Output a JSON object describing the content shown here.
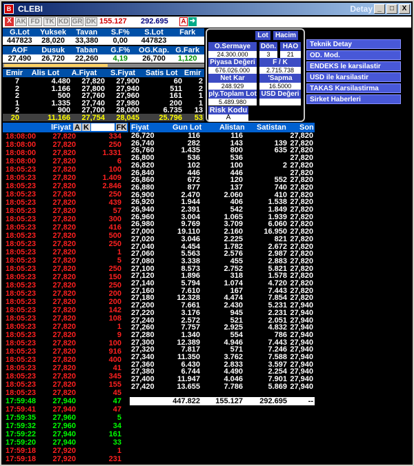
{
  "window": {
    "title": "CLEBI",
    "subtitle": "Detay",
    "buttons": {
      "minimize": "_",
      "maximize": "□",
      "close": "X"
    }
  },
  "toolbar": {
    "close_box": "X",
    "tabs": [
      "AK",
      "FD",
      "TK",
      "KD",
      "GR",
      "DK"
    ],
    "value1": "155.127",
    "value2": "292.695",
    "a_label": "A"
  },
  "quote": {
    "header1": [
      "G.Lot",
      "Yuksek",
      "Tavan",
      "S.F%",
      "S.Lot",
      "Fark"
    ],
    "values1": [
      "447823",
      "28,020",
      "33,380",
      "0,00",
      "447823",
      ""
    ],
    "header2": [
      "AOF",
      "Dusuk",
      "Taban",
      "G.F%",
      "OG.Kap.",
      "G.Fark"
    ],
    "values2": [
      "27,490",
      "26,720",
      "22,260",
      "4,19",
      "26,700",
      "1,120"
    ],
    "orders_header": [
      "Emir",
      "Alis Lot",
      "A.Fiyat",
      "S.Fiyat",
      "Satis Lot",
      "Emir"
    ],
    "orders": [
      [
        "7",
        "4.480",
        "27,820",
        "27,900",
        "60",
        "2"
      ],
      [
        "2",
        "1.166",
        "27,800",
        "27,940",
        "511",
        "2"
      ],
      [
        "2",
        "500",
        "27,760",
        "27,960",
        "161",
        "1"
      ],
      [
        "1",
        "1.335",
        "27,740",
        "27,980",
        "200",
        "1"
      ],
      [
        "2",
        "900",
        "27,700",
        "28,000",
        "6.735",
        "13"
      ],
      [
        "20",
        "11.166",
        "27,754",
        "28,045",
        "25.796",
        "53"
      ]
    ]
  },
  "detail": {
    "tabs": [
      "Lot",
      "Hacim"
    ],
    "o_sermaye_label": "O.Sermaye",
    "o_sermaye_value": "24.300.000",
    "don_label": "Dön.",
    "don_value": "3",
    "hao_label": "HAO",
    "hao_value": "21",
    "piyasa_label": "Piyasa Değeri",
    "piyasa_value": "676.026.000",
    "fk_label": "F / K",
    "fk_value": "2.715.738",
    "netkar_label": "Net Kar",
    "netkar_value": "248.929",
    "sapma_label": "'Sapma",
    "sapma_value": "16.5000",
    "plytoplam_label": "ply.Toplam Lot",
    "plytoplam_value": "5.489.980",
    "usd_label": "USD Değeri",
    "risk_label": "Risk Kodu",
    "risk_value": "A"
  },
  "links": [
    "Teknik Detay",
    "OD. Mod.",
    "ENDEKS le karsilastir",
    "USD ile karsilastir",
    "TAKAS Karsilastirma",
    "Sirket Haberleri"
  ],
  "order_list": {
    "header": {
      "price": "lFiyat",
      "a": "A",
      "k": "K",
      "fk": "FK"
    },
    "rows": [
      [
        "18:08:00",
        "27,820",
        "334",
        "r"
      ],
      [
        "18:08:00",
        "27,820",
        "250",
        "r"
      ],
      [
        "18:08:00",
        "27,820",
        "1.331",
        "r"
      ],
      [
        "18:08:00",
        "27,820",
        "6",
        "r"
      ],
      [
        "18:05:23",
        "27,820",
        "100",
        "r"
      ],
      [
        "18:05:23",
        "27,820",
        "1.409",
        "r"
      ],
      [
        "18:05:23",
        "27,820",
        "2.846",
        "r"
      ],
      [
        "18:05:23",
        "27,820",
        "250",
        "r"
      ],
      [
        "18:05:23",
        "27,820",
        "439",
        "r"
      ],
      [
        "18:05:23",
        "27,820",
        "57",
        "r"
      ],
      [
        "18:05:23",
        "27,820",
        "300",
        "r"
      ],
      [
        "18:05:23",
        "27,820",
        "416",
        "r"
      ],
      [
        "18:05:23",
        "27,820",
        "500",
        "r"
      ],
      [
        "18:05:23",
        "27,820",
        "250",
        "r"
      ],
      [
        "18:05:23",
        "27,820",
        "1",
        "r"
      ],
      [
        "18:05:23",
        "27,820",
        "5",
        "r"
      ],
      [
        "18:05:23",
        "27,820",
        "250",
        "r"
      ],
      [
        "18:05:23",
        "27,820",
        "150",
        "r"
      ],
      [
        "18:05:23",
        "27,820",
        "250",
        "r"
      ],
      [
        "18:05:23",
        "27,820",
        "200",
        "r"
      ],
      [
        "18:05:23",
        "27,820",
        "200",
        "r"
      ],
      [
        "18:05:23",
        "27,820",
        "142",
        "r"
      ],
      [
        "18:05:23",
        "27,820",
        "108",
        "r"
      ],
      [
        "18:05:23",
        "27,820",
        "1",
        "r"
      ],
      [
        "18:05:23",
        "27,820",
        "9",
        "r"
      ],
      [
        "18:05:23",
        "27,820",
        "100",
        "r"
      ],
      [
        "18:05:23",
        "27,820",
        "916",
        "r"
      ],
      [
        "18:05:23",
        "27,820",
        "400",
        "r"
      ],
      [
        "18:05:23",
        "27,820",
        "41",
        "r"
      ],
      [
        "18:05:23",
        "27,820",
        "345",
        "r"
      ],
      [
        "18:05:23",
        "27,820",
        "155",
        "r"
      ],
      [
        "18:05:23",
        "27,820",
        "45",
        "r"
      ],
      [
        "17:59:48",
        "27,940",
        "47",
        "g"
      ],
      [
        "17:59:41",
        "27,940",
        "47",
        "r"
      ],
      [
        "17:59:35",
        "27,960",
        "5",
        "g"
      ],
      [
        "17:59:32",
        "27,960",
        "34",
        "g"
      ],
      [
        "17:59:22",
        "27,940",
        "161",
        "g"
      ],
      [
        "17:59:20",
        "27,940",
        "33",
        "g"
      ],
      [
        "17:59:18",
        "27,920",
        "1",
        "r"
      ],
      [
        "17:59:18",
        "27,920",
        "231",
        "r"
      ]
    ]
  },
  "stats": {
    "header": [
      "Fiyat",
      "Gun Lot",
      "Alistan",
      "Satistan",
      "Son"
    ],
    "rows": [
      [
        "26,720",
        "116",
        "116",
        "",
        "27,820"
      ],
      [
        "26,740",
        "282",
        "143",
        "139",
        "27,820"
      ],
      [
        "26,760",
        "1.435",
        "800",
        "635",
        "27,820"
      ],
      [
        "26,800",
        "536",
        "536",
        "",
        "27,820"
      ],
      [
        "26,820",
        "102",
        "100",
        "2",
        "27,820"
      ],
      [
        "26,840",
        "446",
        "446",
        "",
        "27,820"
      ],
      [
        "26,860",
        "672",
        "120",
        "552",
        "27,820"
      ],
      [
        "26,880",
        "877",
        "137",
        "740",
        "27,820"
      ],
      [
        "26,900",
        "2.470",
        "2.060",
        "410",
        "27,820"
      ],
      [
        "26,920",
        "1.944",
        "406",
        "1.538",
        "27,820"
      ],
      [
        "26,940",
        "2.391",
        "542",
        "1.849",
        "27,820"
      ],
      [
        "26,960",
        "3.004",
        "1.065",
        "1.939",
        "27,820"
      ],
      [
        "26,980",
        "9.769",
        "3.709",
        "6.060",
        "27,820"
      ],
      [
        "27,000",
        "19.110",
        "2.160",
        "16.950",
        "27,820"
      ],
      [
        "27,020",
        "3.046",
        "2.225",
        "821",
        "27,820"
      ],
      [
        "27,040",
        "4.454",
        "1.782",
        "2.672",
        "27,820"
      ],
      [
        "27,060",
        "5.563",
        "2.576",
        "2.987",
        "27,820"
      ],
      [
        "27,080",
        "3.338",
        "455",
        "2.883",
        "27,820"
      ],
      [
        "27,100",
        "8.573",
        "2.752",
        "5.821",
        "27,820"
      ],
      [
        "27,120",
        "1.896",
        "318",
        "1.578",
        "27,820"
      ],
      [
        "27,140",
        "5.794",
        "1.074",
        "4.720",
        "27,820"
      ],
      [
        "27,160",
        "7.610",
        "167",
        "7.443",
        "27,820"
      ],
      [
        "27,180",
        "12.328",
        "4.474",
        "7.854",
        "27,820"
      ],
      [
        "27,200",
        "7.661",
        "2.430",
        "5.231",
        "27,940"
      ],
      [
        "27,220",
        "3.176",
        "945",
        "2.231",
        "27,940"
      ],
      [
        "27,240",
        "2.572",
        "521",
        "2.051",
        "27,940"
      ],
      [
        "27,260",
        "7.757",
        "2.925",
        "4.832",
        "27,940"
      ],
      [
        "27,280",
        "1.340",
        "554",
        "786",
        "27,940"
      ],
      [
        "27,300",
        "12.389",
        "4.946",
        "7.443",
        "27,940"
      ],
      [
        "27,320",
        "7.817",
        "571",
        "7.246",
        "27,940"
      ],
      [
        "27,340",
        "11.350",
        "3.762",
        "7.588",
        "27,940"
      ],
      [
        "27,360",
        "6.430",
        "2.833",
        "3.597",
        "27,940"
      ],
      [
        "27,380",
        "6.744",
        "4.490",
        "2.254",
        "27,940"
      ],
      [
        "27,400",
        "11.947",
        "4.046",
        "7.901",
        "27,940"
      ],
      [
        "27,420",
        "13.655",
        "7.786",
        "5.869",
        "27,940"
      ]
    ],
    "totals": [
      "",
      "447.822",
      "155.127",
      "292.695",
      "--"
    ]
  },
  "colors": {
    "red": "#ff2020",
    "green": "#00ff00",
    "yellow": "#ffff00",
    "blue_header": "#0050a8"
  }
}
